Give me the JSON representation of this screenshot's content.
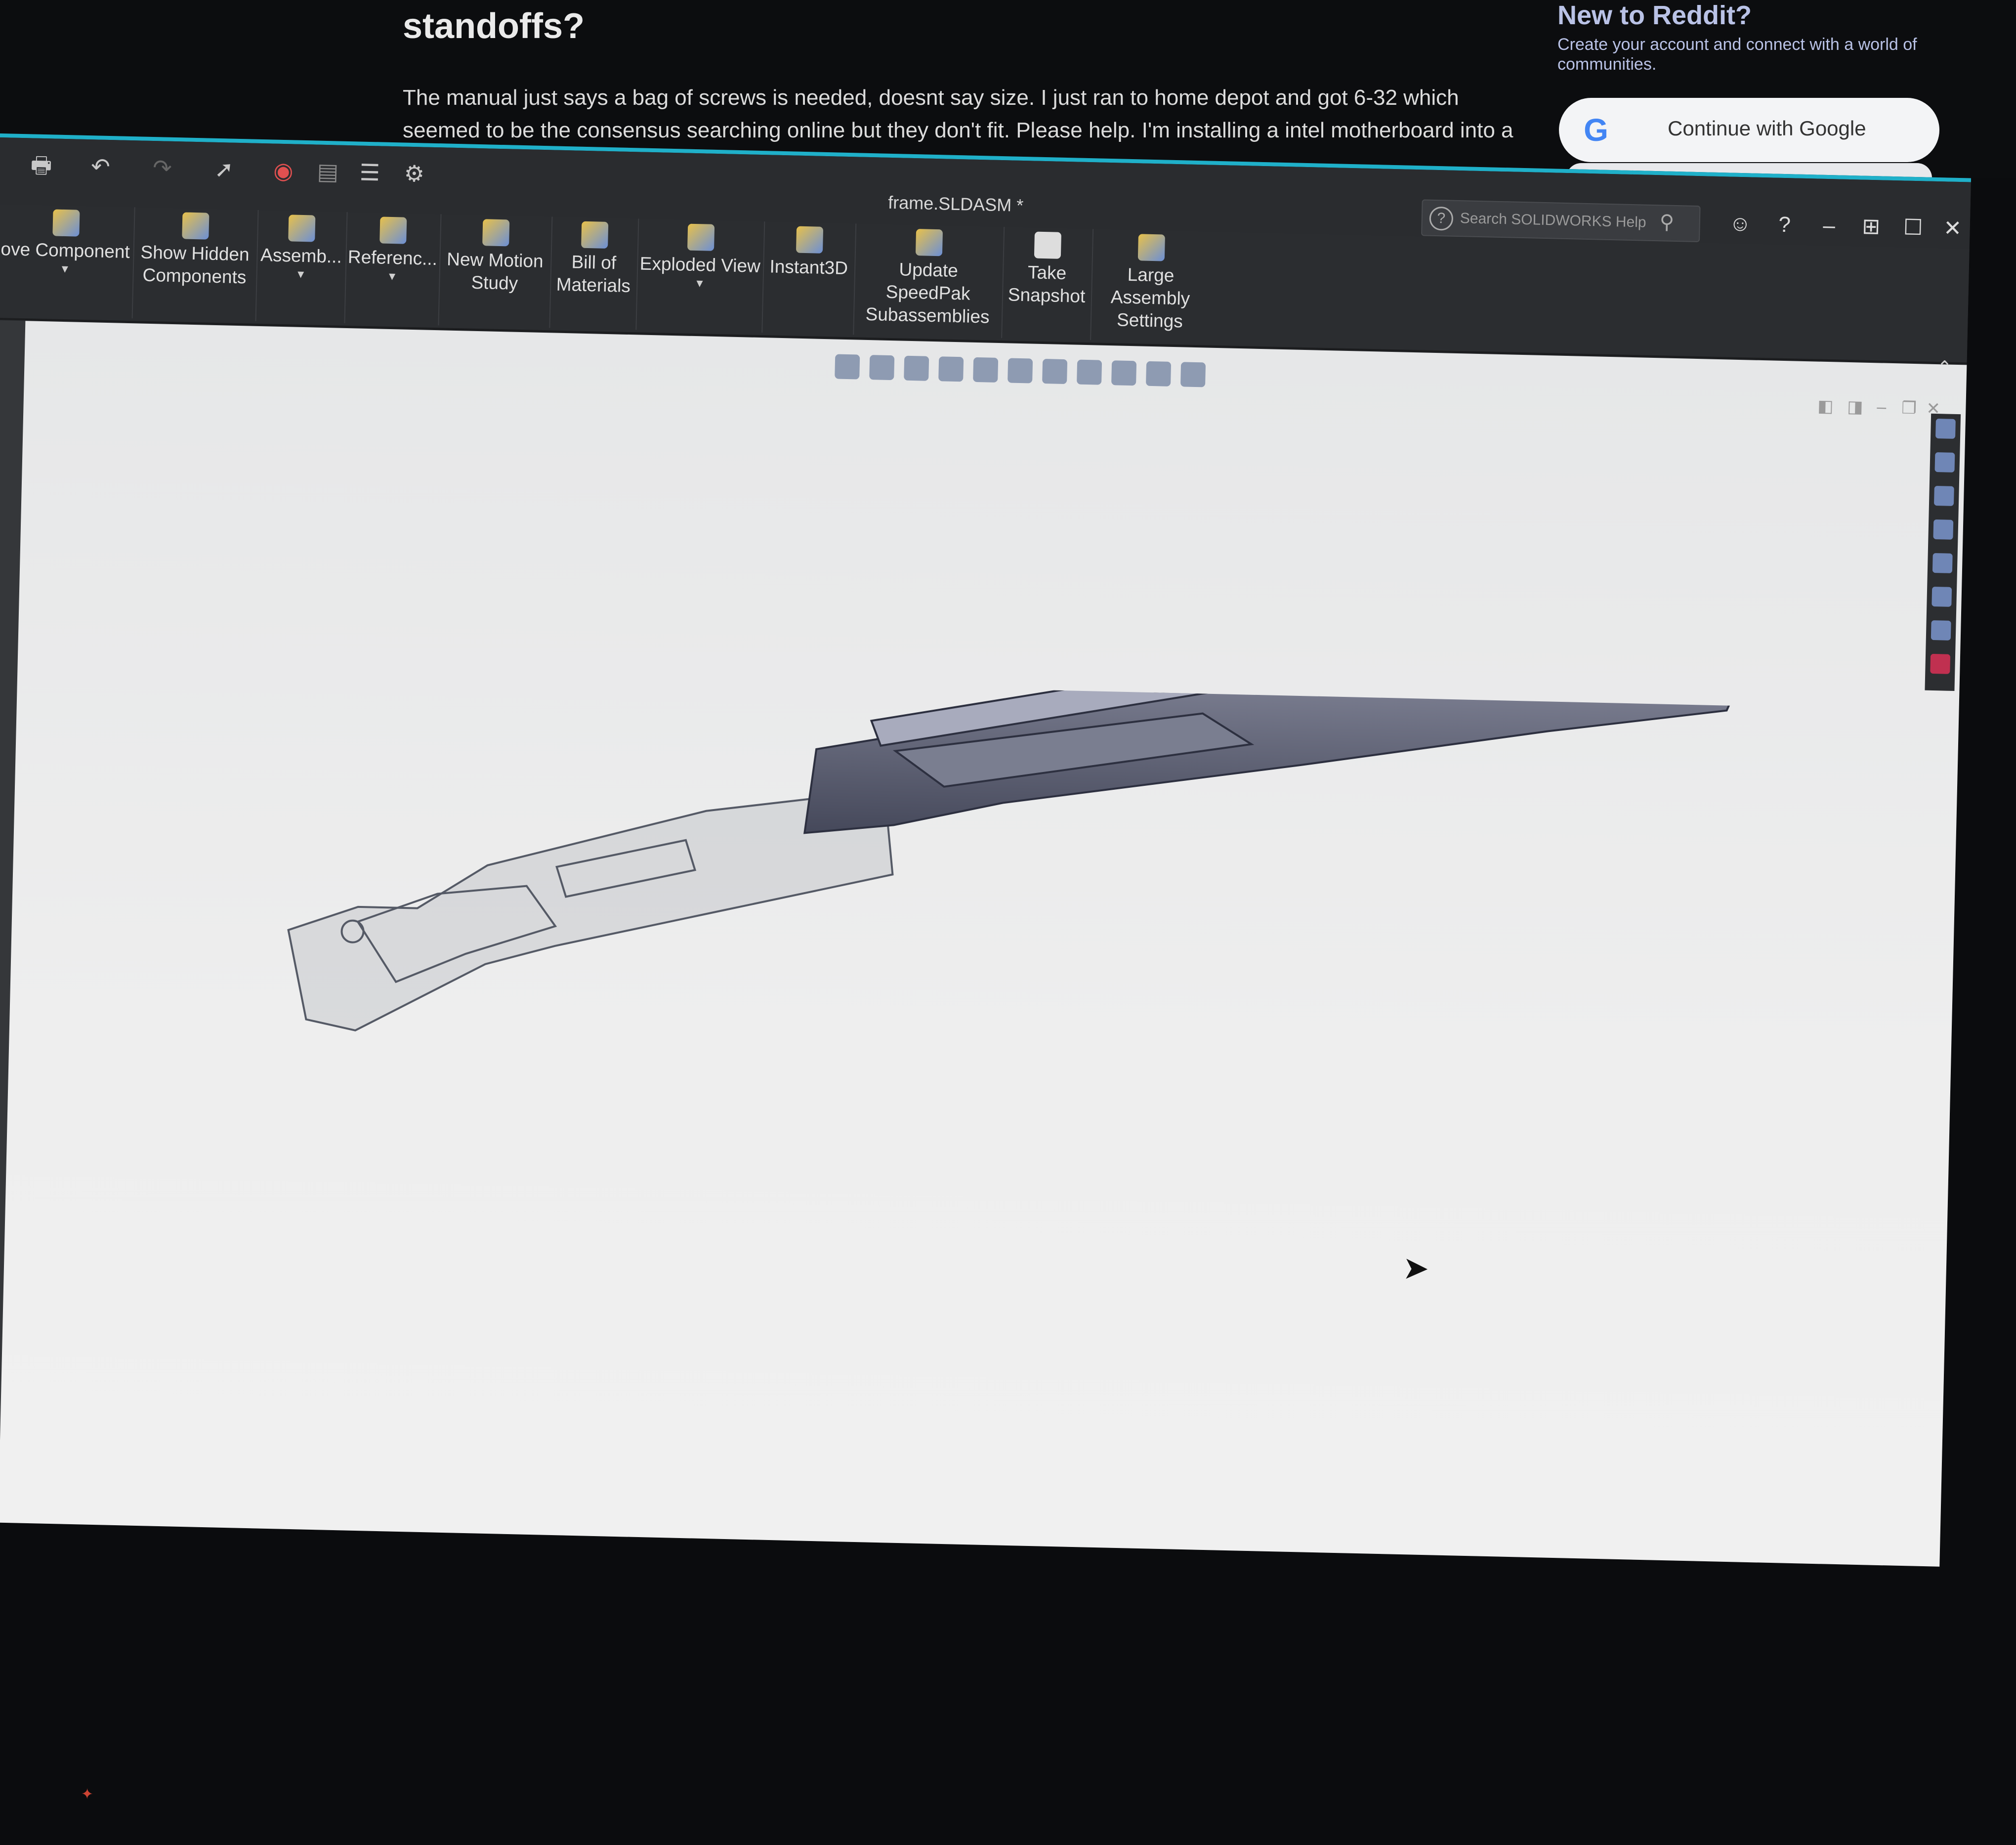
{
  "reddit": {
    "post_title": "What size screw is needes to screw the motherboard into the standoffs?",
    "post_body": "The manual just says a bag of screws is needed, doesnt say size. I just ran to home depot and got 6-32 which seemed to be the consensus searching online but they don't fit. Please help. I'm installing a intel motherboard into a Phanteks",
    "sidebar_title": "New to Reddit?",
    "sidebar_text": "Create your account and connect with a world of communities.",
    "google_button": "Continue with Google"
  },
  "solidworks": {
    "title": "frame.SLDASM *",
    "search_placeholder": "Search SOLIDWORKS Help",
    "ribbon": [
      {
        "label": "ove Component",
        "dropdown": true
      },
      {
        "label": "Show Hidden Components",
        "dropdown": false
      },
      {
        "label": "Assemb...",
        "dropdown": true
      },
      {
        "label": "Referenc...",
        "dropdown": true
      },
      {
        "label": "New Motion Study",
        "dropdown": false
      },
      {
        "label": "Bill of Materials",
        "dropdown": false
      },
      {
        "label": "Exploded View",
        "dropdown": true
      },
      {
        "label": "Instant3D",
        "dropdown": false
      },
      {
        "label": "Update SpeedPak Subassemblies",
        "dropdown": false
      },
      {
        "label": "Take Snapshot",
        "dropdown": false
      },
      {
        "label": "Large Assembly Settings",
        "dropdown": false
      }
    ],
    "icons": {
      "help": "?",
      "search": "⚲",
      "minimize": "–",
      "tile": "⊞",
      "maximize": "☐",
      "close": "✕",
      "collapse": "⌃",
      "dropdown": "▾",
      "cursor": "➤",
      "triad": "✦"
    },
    "colors": {
      "accent": "#1fb0c9",
      "ribbon_bg": "#2b2d30",
      "viewport_bg": "#ececec",
      "model": "#5d6073"
    }
  }
}
